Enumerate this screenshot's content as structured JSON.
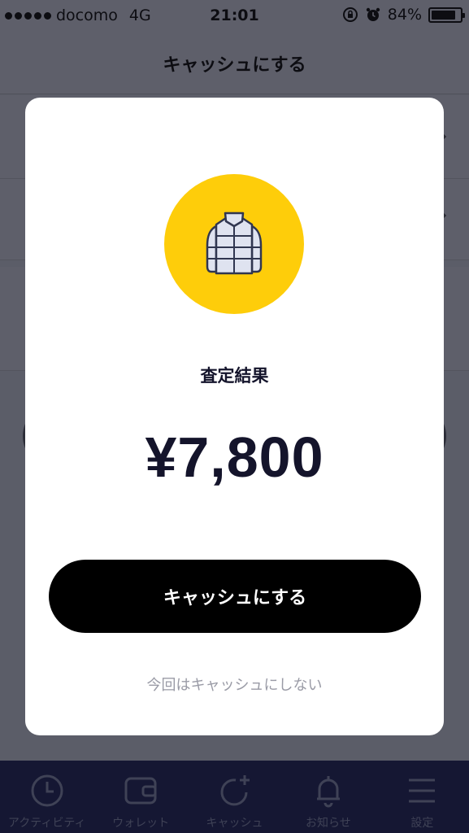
{
  "status_bar": {
    "carrier": "docomo",
    "network": "4G",
    "time": "21:01",
    "battery": "84%",
    "battery_level": 0.84
  },
  "nav": {
    "title": "キャッシュにする"
  },
  "modal": {
    "item_icon": "down-jacket-icon",
    "result_label": "査定結果",
    "amount": "¥7,800",
    "primary_button": "キャッシュにする",
    "secondary_link": "今回はキャッシュにしない"
  },
  "tab_bar": {
    "items": [
      {
        "label": "アクティビティ",
        "icon": "clock-icon"
      },
      {
        "label": "ウォレット",
        "icon": "wallet-icon"
      },
      {
        "label": "キャッシュ",
        "icon": "cash-add-icon"
      },
      {
        "label": "お知らせ",
        "icon": "bell-icon"
      },
      {
        "label": "設定",
        "icon": "menu-icon"
      }
    ]
  },
  "colors": {
    "badge": "#fecd0a",
    "button": "#000000",
    "tab_bar": "#151733"
  }
}
